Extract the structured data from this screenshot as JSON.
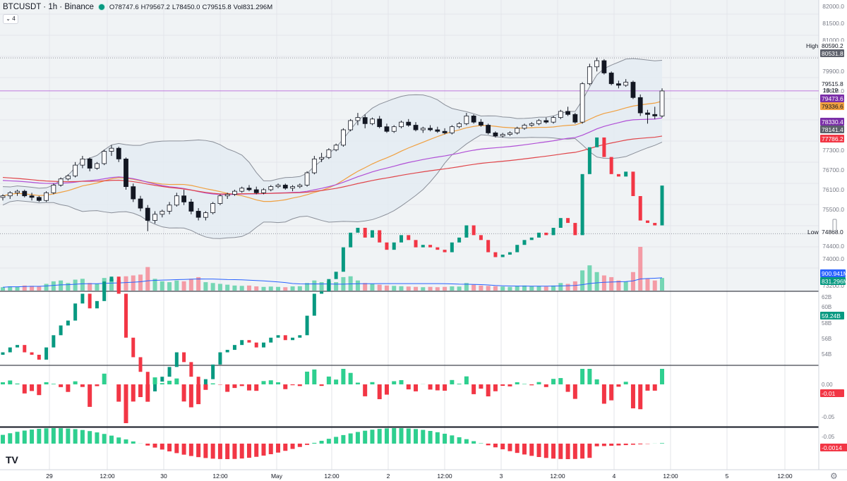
{
  "header": {
    "symbol": "BTCUSDT · 1h · Binance",
    "open": "O78747.6",
    "high": "H79567.2",
    "low": "L78450.0",
    "close": "C79515.8",
    "vol": "Vol831.296M",
    "indicators_count": "4"
  },
  "colors": {
    "up": "#089981",
    "down": "#f23645",
    "bg_band": "#eef1f4"
  },
  "price_axis": [
    "82000.0",
    "81500.0",
    "81000.0",
    "79900.0",
    "79600.0",
    "77300.0",
    "76700.0",
    "76100.0",
    "75500.0",
    "74400.0",
    "74000.0",
    "73200.0"
  ],
  "labels": {
    "high_tag": "High",
    "high_value": "80590.2",
    "high_value2": "80531.8",
    "low_tag": "Low",
    "low_value": "74868.0",
    "last_price": "79515.8",
    "countdown": "18:19",
    "bb_upper": "79473.6",
    "ma_orange": "79336.6",
    "ma_purple": "78330.4",
    "bb_lower": "78141.4",
    "ma_red": "77786.2",
    "vol_ma": "900.941M",
    "vol_last": "831.296M"
  },
  "pane2": {
    "axis": [
      "62B",
      "60B",
      "58B",
      "56B",
      "54B"
    ],
    "last": "59.24B"
  },
  "pane3": {
    "axis": [
      "0.00",
      "-0.05"
    ],
    "last": "-0.01"
  },
  "pane4": {
    "axis": [
      "-0.05"
    ],
    "last": "-0.0014"
  },
  "time_axis": [
    "29",
    "12:00",
    "30",
    "12:00",
    "May",
    "12:00",
    "2",
    "12:00",
    "3",
    "12:00",
    "4",
    "12:00",
    "5",
    "12:00"
  ],
  "chart_data": {
    "type": "candlestick",
    "price_range": [
      73200,
      82200
    ],
    "candles": [
      [
        76050,
        76150,
        75950,
        76100,
        20
      ],
      [
        76100,
        76250,
        76000,
        76200,
        25
      ],
      [
        76200,
        76300,
        76100,
        76250,
        22
      ],
      [
        76250,
        76300,
        76050,
        76100,
        30
      ],
      [
        76100,
        76200,
        75950,
        76050,
        28
      ],
      [
        76050,
        76100,
        75900,
        75950,
        26
      ],
      [
        75950,
        76250,
        75900,
        76200,
        40
      ],
      [
        76200,
        76500,
        76150,
        76450,
        55
      ],
      [
        76450,
        76700,
        76400,
        76650,
        60
      ],
      [
        76650,
        76800,
        76600,
        76750,
        45
      ],
      [
        76750,
        77200,
        76700,
        77100,
        65
      ],
      [
        77100,
        77400,
        77000,
        77300,
        70
      ],
      [
        77300,
        77350,
        76900,
        77000,
        45
      ],
      [
        77000,
        77200,
        76950,
        77150,
        40
      ],
      [
        77150,
        77600,
        77100,
        77550,
        75
      ],
      [
        77550,
        77750,
        77400,
        77650,
        70
      ],
      [
        77650,
        77700,
        77200,
        77300,
        60
      ],
      [
        77300,
        77350,
        76300,
        76400,
        85
      ],
      [
        76400,
        76500,
        75900,
        76000,
        90
      ],
      [
        76000,
        76100,
        75600,
        75700,
        95
      ],
      [
        75700,
        75800,
        74950,
        75300,
        140
      ],
      [
        75300,
        75600,
        75200,
        75500,
        70
      ],
      [
        75500,
        75650,
        75400,
        75600,
        55
      ],
      [
        75600,
        75900,
        75500,
        75800,
        50
      ],
      [
        75800,
        76200,
        75750,
        76100,
        60
      ],
      [
        76100,
        76300,
        75800,
        75900,
        55
      ],
      [
        75900,
        76000,
        75500,
        75600,
        70
      ],
      [
        75600,
        75700,
        75300,
        75400,
        80
      ],
      [
        75400,
        75600,
        75300,
        75550,
        50
      ],
      [
        75550,
        75900,
        75500,
        75850,
        45
      ],
      [
        75850,
        76150,
        75800,
        76100,
        40
      ],
      [
        76100,
        76200,
        76000,
        76150,
        35
      ],
      [
        76150,
        76300,
        76100,
        76250,
        30
      ],
      [
        76250,
        76400,
        76200,
        76350,
        28
      ],
      [
        76350,
        76450,
        76250,
        76300,
        30
      ],
      [
        76300,
        76400,
        76150,
        76200,
        25
      ],
      [
        76200,
        76350,
        76150,
        76300,
        22
      ],
      [
        76300,
        76450,
        76250,
        76400,
        24
      ],
      [
        76400,
        76500,
        76350,
        76450,
        22
      ],
      [
        76450,
        76500,
        76300,
        76350,
        20
      ],
      [
        76350,
        76450,
        76250,
        76400,
        25
      ],
      [
        76400,
        76500,
        76350,
        76450,
        26
      ],
      [
        76450,
        76900,
        76400,
        76850,
        45
      ],
      [
        76850,
        77400,
        76800,
        77300,
        60
      ],
      [
        77300,
        77500,
        77200,
        77350,
        50
      ],
      [
        77350,
        77650,
        77300,
        77600,
        55
      ],
      [
        77600,
        77800,
        77550,
        77750,
        50
      ],
      [
        77750,
        78300,
        77700,
        78250,
        80
      ],
      [
        78250,
        78600,
        78200,
        78550,
        85
      ],
      [
        78550,
        78800,
        78400,
        78650,
        60
      ],
      [
        78650,
        78750,
        78300,
        78450,
        45
      ],
      [
        78450,
        78650,
        78400,
        78600,
        40
      ],
      [
        78600,
        78700,
        78300,
        78350,
        35
      ],
      [
        78350,
        78450,
        78150,
        78200,
        30
      ],
      [
        78200,
        78400,
        78150,
        78350,
        28
      ],
      [
        78350,
        78550,
        78300,
        78500,
        26
      ],
      [
        78500,
        78600,
        78350,
        78400,
        24
      ],
      [
        78400,
        78500,
        78200,
        78250,
        22
      ],
      [
        78250,
        78350,
        78150,
        78300,
        20
      ],
      [
        78300,
        78400,
        78200,
        78250,
        22
      ],
      [
        78250,
        78350,
        78150,
        78200,
        20
      ],
      [
        78200,
        78300,
        78100,
        78150,
        22
      ],
      [
        78150,
        78400,
        78100,
        78350,
        25
      ],
      [
        78350,
        78500,
        78300,
        78450,
        24
      ],
      [
        78450,
        78800,
        78400,
        78700,
        45
      ],
      [
        78700,
        78750,
        78450,
        78500,
        35
      ],
      [
        78500,
        78600,
        78350,
        78400,
        30
      ],
      [
        78400,
        78450,
        78100,
        78150,
        28
      ],
      [
        78150,
        78200,
        78000,
        78050,
        26
      ],
      [
        78050,
        78150,
        78000,
        78100,
        24
      ],
      [
        78100,
        78200,
        78050,
        78150,
        22
      ],
      [
        78150,
        78350,
        78100,
        78300,
        28
      ],
      [
        78300,
        78450,
        78250,
        78400,
        30
      ],
      [
        78400,
        78500,
        78350,
        78450,
        26
      ],
      [
        78450,
        78600,
        78400,
        78550,
        28
      ],
      [
        78550,
        78650,
        78450,
        78500,
        24
      ],
      [
        78500,
        78700,
        78450,
        78650,
        30
      ],
      [
        78650,
        78900,
        78600,
        78850,
        45
      ],
      [
        78850,
        79000,
        78700,
        78750,
        40
      ],
      [
        78750,
        78800,
        78450,
        78500,
        55
      ],
      [
        78500,
        79800,
        78450,
        79750,
        120
      ],
      [
        79750,
        80400,
        79700,
        80300,
        150
      ],
      [
        80300,
        80600,
        80150,
        80500,
        110
      ],
      [
        80500,
        80550,
        80050,
        80100,
        90
      ],
      [
        80100,
        80150,
        79700,
        79750,
        80
      ],
      [
        79750,
        79850,
        79600,
        79700,
        60
      ],
      [
        79700,
        79900,
        79650,
        79800,
        55
      ],
      [
        79800,
        79850,
        79250,
        79300,
        110
      ],
      [
        79300,
        79400,
        78700,
        78800,
        260
      ],
      [
        78800,
        78900,
        78450,
        78750,
        70
      ],
      [
        78750,
        79000,
        78600,
        78700,
        60
      ],
      [
        78700,
        79600,
        78650,
        79515,
        75
      ]
    ],
    "volume_ma_last": 900.941,
    "volume_last": 831.296
  }
}
